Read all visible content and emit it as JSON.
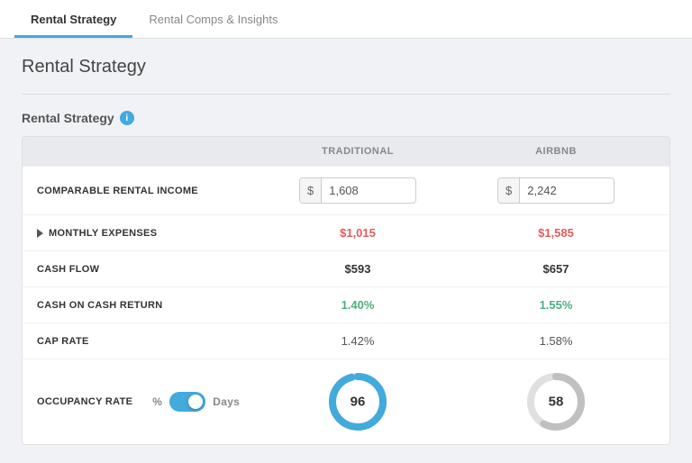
{
  "tabs": [
    {
      "id": "rental-strategy",
      "label": "Rental Strategy",
      "active": true
    },
    {
      "id": "rental-comps",
      "label": "Rental Comps & Insights",
      "active": false
    }
  ],
  "page": {
    "title": "Rental Strategy"
  },
  "section": {
    "heading": "Rental Strategy",
    "info_icon": "i"
  },
  "table": {
    "headers": {
      "col1": "",
      "col2": "TRADITIONAL",
      "col3": "AIRBNB"
    },
    "rows": [
      {
        "id": "comparable-rental-income",
        "label": "COMPARABLE RENTAL INCOME",
        "trad_prefix": "$",
        "trad_value": "1,608",
        "airbnb_prefix": "$",
        "airbnb_value": "2,242",
        "type": "input"
      },
      {
        "id": "monthly-expenses",
        "label": "MONTHLY EXPENSES",
        "has_triangle": true,
        "trad_value": "$1,015",
        "airbnb_value": "$1,585",
        "type": "red"
      },
      {
        "id": "cash-flow",
        "label": "CASH FLOW",
        "trad_value": "$593",
        "airbnb_value": "$657",
        "type": "bold"
      },
      {
        "id": "cash-on-cash-return",
        "label": "CASH ON CASH RETURN",
        "trad_value": "1.40%",
        "airbnb_value": "1.55%",
        "type": "green"
      },
      {
        "id": "cap-rate",
        "label": "CAP RATE",
        "trad_value": "1.42%",
        "airbnb_value": "1.58%",
        "type": "plain"
      },
      {
        "id": "occupancy-rate",
        "label": "OCCUPANCY RATE",
        "trad_donut": 96,
        "trad_donut_max": 100,
        "airbnb_donut": 58,
        "airbnb_donut_max": 100,
        "trad_color": "#42aadc",
        "airbnb_color": "#c0c0c0",
        "type": "donut",
        "toggle_pct": "%",
        "toggle_days": "Days"
      }
    ]
  }
}
